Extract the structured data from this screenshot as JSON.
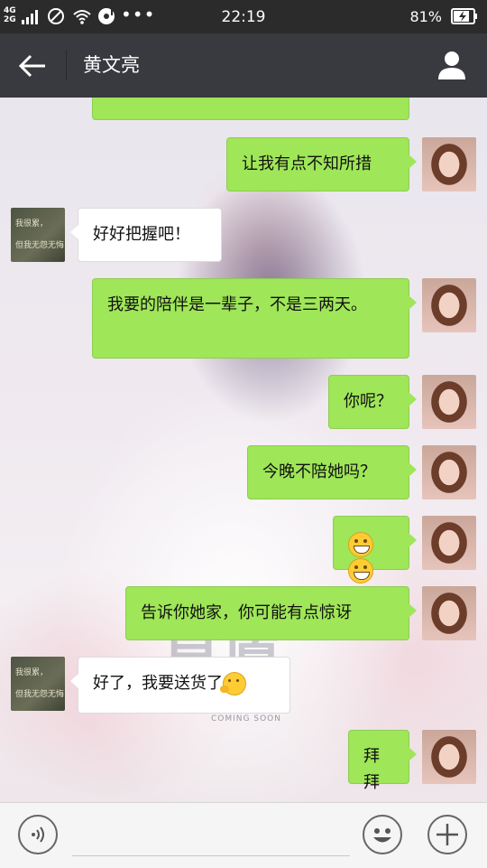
{
  "status_bar": {
    "network_4g": "4G",
    "network_2g": "2G",
    "more": "•••",
    "time": "22:19",
    "battery_percent": "81%",
    "battery_level": 0.81
  },
  "header": {
    "title": "黄文亮"
  },
  "background": {
    "watermark": "星愿",
    "coming_soon": "COMING SOON"
  },
  "contact_avatar": {
    "line1": "我很累，",
    "line2": "但我无怨无悔"
  },
  "messages": [
    {
      "side": "right",
      "text": "让我有点不知所措"
    },
    {
      "side": "left",
      "text": "好好把握吧！"
    },
    {
      "side": "right",
      "text": "我要的陪伴是一辈子，不是三两天。"
    },
    {
      "side": "right",
      "text": "你呢？"
    },
    {
      "side": "right",
      "text": "今晚不陪她吗？"
    },
    {
      "side": "right",
      "text": "😁😁"
    },
    {
      "side": "right",
      "text": "告诉你她家，你可能有点惊讶"
    },
    {
      "side": "left",
      "text": "好了，我要送货了"
    },
    {
      "side": "right",
      "text": "拜拜"
    }
  ],
  "input_bar": {
    "voice_icon": "voice-icon",
    "emoji_icon": "smiley-icon",
    "plus_icon": "plus-icon"
  },
  "colors": {
    "status_bar": "#2b2b2b",
    "title_bar": "#393a3f",
    "bubble_right": "#9fe658",
    "bubble_left": "#ffffff"
  }
}
